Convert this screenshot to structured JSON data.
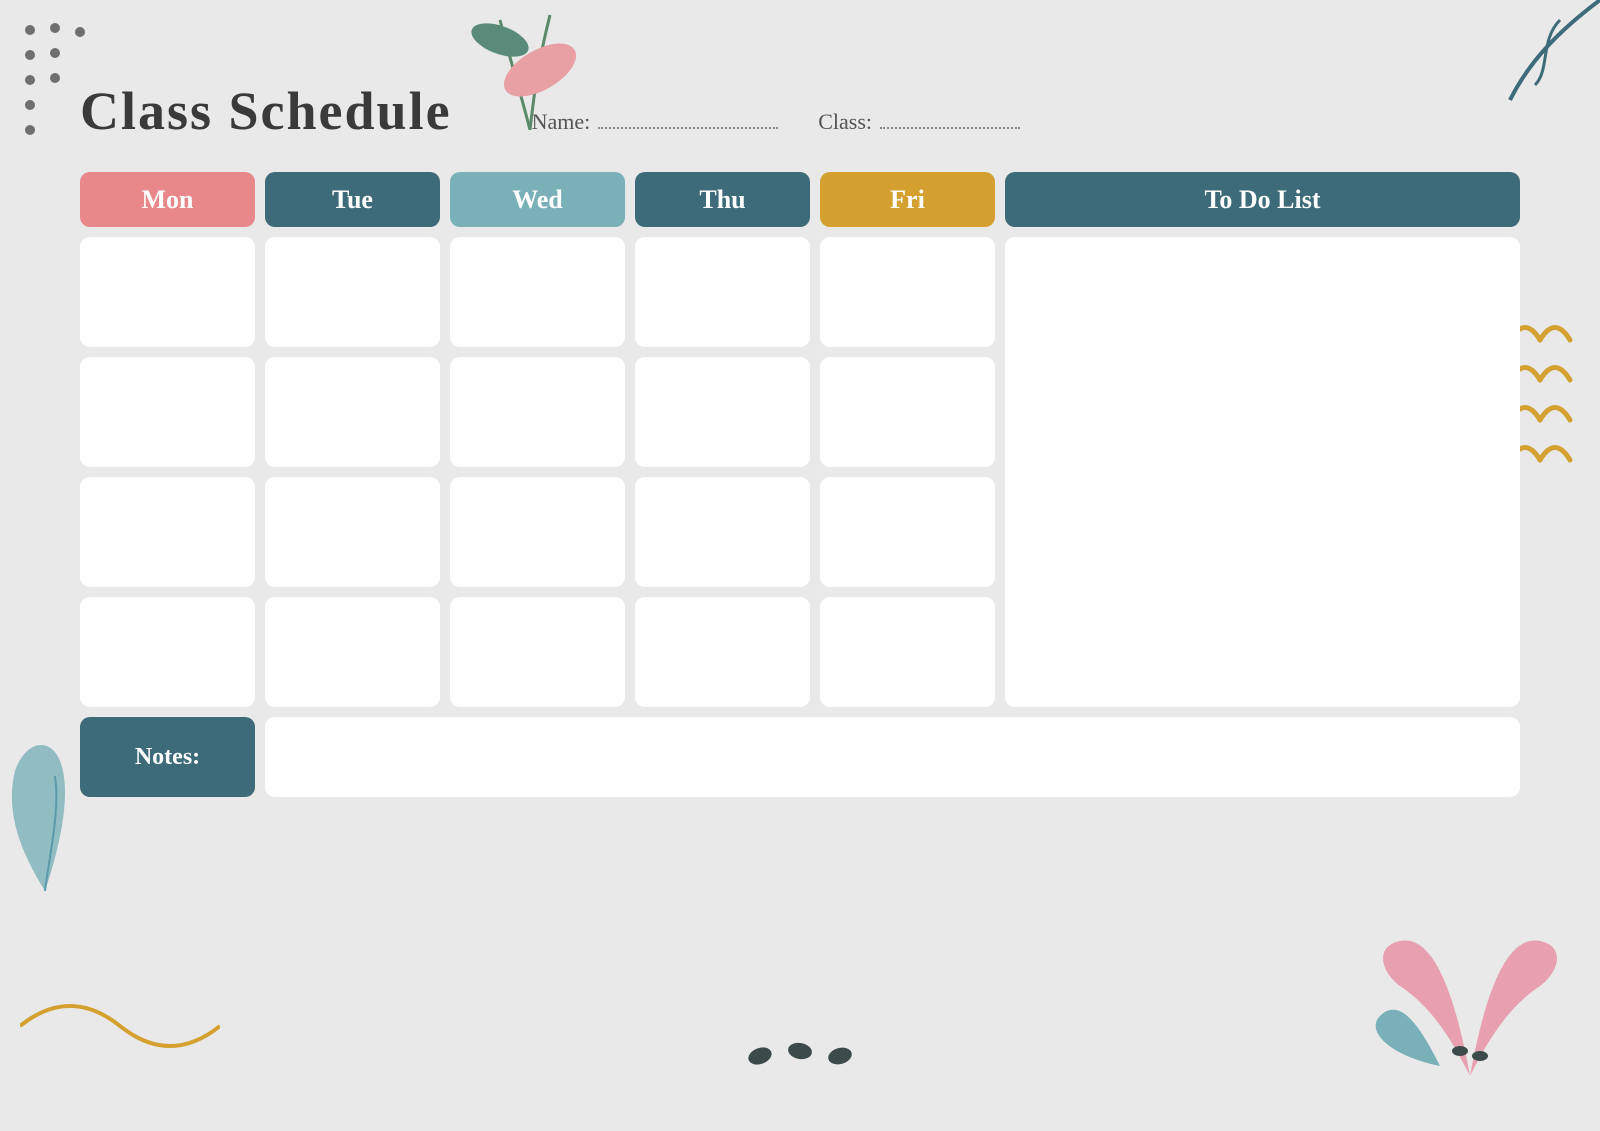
{
  "title": "Class Schedule",
  "fields": {
    "name_label": "Name:",
    "class_label": "Class:"
  },
  "days": [
    "Mon",
    "Tue",
    "Wed",
    "Thu",
    "Fri",
    "To Do List"
  ],
  "notes_label": "Notes:",
  "colors": {
    "mon": "#e8888a",
    "tue": "#3d6b7a",
    "wed": "#7ab0b8",
    "thu": "#3d6b7a",
    "fri": "#d4a030",
    "todo": "#3d6b7a",
    "notes": "#3d6b7a",
    "background": "#e8e9e8"
  },
  "arches": [
    "⌢",
    "⌢",
    "⌢",
    "⌢"
  ],
  "rows": 4
}
